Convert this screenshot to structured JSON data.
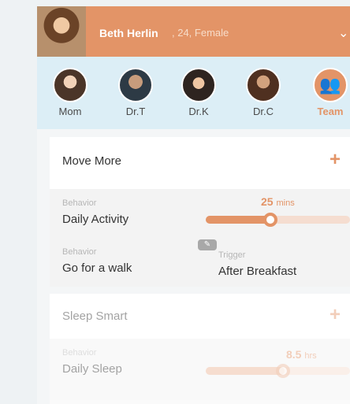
{
  "header": {
    "user_name": "Beth Herlin",
    "user_meta": ", 24, Female",
    "chevron": "⌄"
  },
  "contacts": [
    {
      "name": "Mom"
    },
    {
      "name": "Dr.T"
    },
    {
      "name": "Dr.K"
    },
    {
      "name": "Dr.C"
    },
    {
      "name": "Team"
    }
  ],
  "goals": [
    {
      "title": "Move More",
      "plus": "+",
      "behavior_label": "Behavior",
      "behavior_1": "Daily Activity",
      "minutes_value": "25",
      "minutes_unit": "mins",
      "behavior_2_label": "Behavior",
      "behavior_2": "Go for a walk",
      "trigger_label": "Trigger",
      "trigger": "After Breakfast"
    },
    {
      "title": "Sleep Smart",
      "plus": "+",
      "behavior_label": "Behavior",
      "behavior_1": "Daily Sleep",
      "hours_value": "8.5",
      "hours_unit": "hrs"
    }
  ]
}
